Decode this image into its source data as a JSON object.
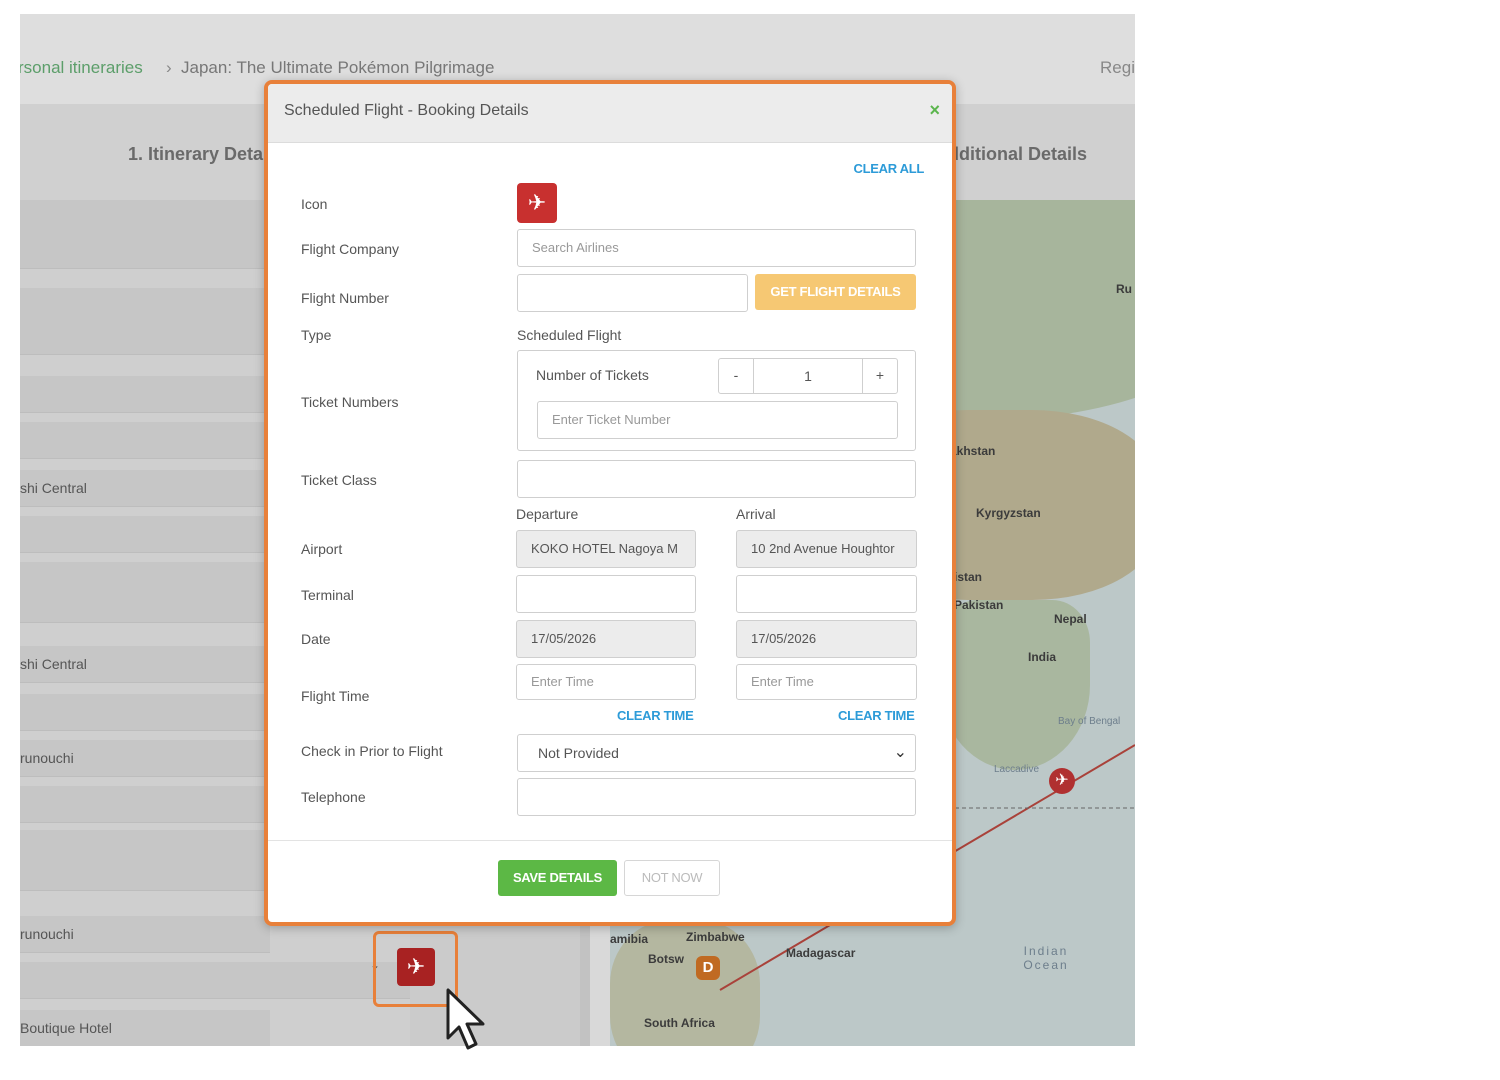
{
  "breadcrumb": {
    "parent": "rsonal itineraries",
    "separator": "›",
    "current": "Japan: The Ultimate Pokémon Pilgrimage",
    "right_text": "Regi"
  },
  "steps": {
    "step1": "1. Itinerary Detai",
    "step4": "dditional Details"
  },
  "left_rows": [
    "shi Central",
    "shi Central",
    "runouchi",
    "runouchi",
    "Boutique Hotel"
  ],
  "map_labels": {
    "ru": "Ru",
    "kazakhstan": "akhstan",
    "kyrgyzstan": "Kyrgyzstan",
    "afghanistan": "istan",
    "pakistan": "Pakistan",
    "nepal": "Nepal",
    "india": "India",
    "bay": "Bay of Bengal",
    "laccadive": "Laccadive",
    "namibia": "amibia",
    "zimbabwe": "Zimbabwe",
    "botswana": "Botsw",
    "madagascar": "Madagascar",
    "south_africa": "South Africa",
    "indian_ocean": "Indian Ocean",
    "d_marker": "D"
  },
  "modal": {
    "title": "Scheduled Flight - Booking Details",
    "close": "×",
    "clear_all": "CLEAR ALL",
    "labels": {
      "icon": "Icon",
      "flight_company": "Flight Company",
      "flight_number": "Flight Number",
      "type": "Type",
      "ticket_numbers": "Ticket Numbers",
      "ticket_class": "Ticket Class",
      "airport": "Airport",
      "terminal": "Terminal",
      "date": "Date",
      "flight_time": "Flight Time",
      "check_in": "Check in Prior to Flight",
      "telephone": "Telephone"
    },
    "flight_company_placeholder": "Search Airlines",
    "flight_number_value": "",
    "get_flight_details": "GET FLIGHT DETAILS",
    "type_value": "Scheduled Flight",
    "number_of_tickets_label": "Number of Tickets",
    "stepper_minus": "-",
    "stepper_plus": "+",
    "tickets_count": "1",
    "ticket_number_placeholder": "Enter Ticket Number",
    "departure_header": "Departure",
    "arrival_header": "Arrival",
    "departure_airport": "KOKO HOTEL Nagoya M",
    "arrival_airport": "10 2nd Avenue Houghtor",
    "departure_date": "17/05/2026",
    "arrival_date": "17/05/2026",
    "time_placeholder": "Enter Time",
    "clear_time": "CLEAR TIME",
    "check_in_value": "Not Provided",
    "save_details": "SAVE DETAILS",
    "not_now": "NOT NOW"
  },
  "colors": {
    "accent_orange": "#e8803a",
    "icon_red": "#c8302f",
    "save_green": "#5cb845",
    "link_blue": "#2d9bd8",
    "get_details_amber": "#f6c873"
  },
  "icons": {
    "flight_icon": "airplane-icon",
    "close_icon": "close-icon",
    "cursor": "mouse-pointer-icon",
    "select_chevron": "chevron-down-icon"
  }
}
